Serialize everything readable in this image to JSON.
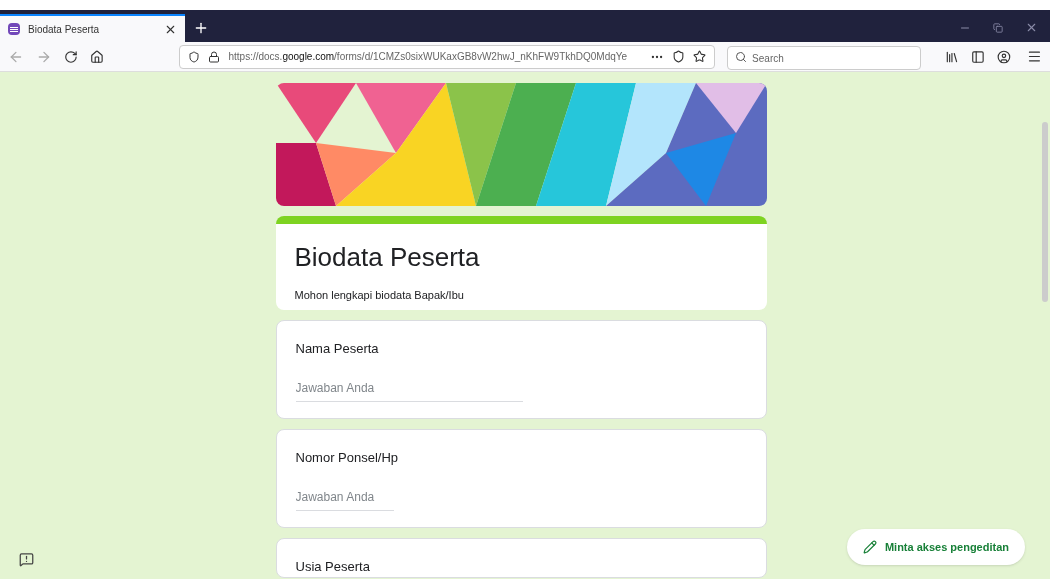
{
  "browser": {
    "tab": {
      "title": "Biodata Peserta"
    },
    "url": {
      "prefix": "https://docs.",
      "domain": "google.com",
      "path": "/forms/d/1CMZs0sixWUKaxGB8vW2hwJ_nKhFW9TkhDQ0MdqYe"
    },
    "search": {
      "placeholder": "Search"
    }
  },
  "form": {
    "title": "Biodata Peserta",
    "description": "Mohon lengkapi biodata Bapak/Ibu",
    "questions": [
      {
        "label": "Nama Peserta",
        "placeholder": "Jawaban Anda",
        "kind": "long"
      },
      {
        "label": "Nomor Ponsel/Hp",
        "placeholder": "Jawaban Anda",
        "kind": "short"
      },
      {
        "label": "Usia Peserta",
        "kind": "cut"
      }
    ]
  },
  "edit_button": {
    "label": "Minta akses pengeditan"
  }
}
